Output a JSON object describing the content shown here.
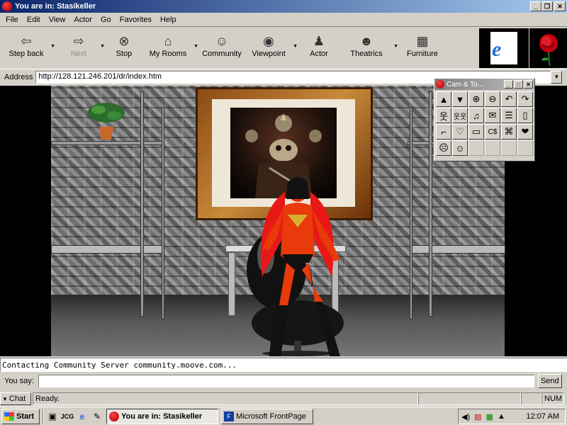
{
  "window": {
    "title": "You are in: Stasikeller"
  },
  "menu": [
    "File",
    "Edit",
    "View",
    "Actor",
    "Go",
    "Favorites",
    "Help"
  ],
  "toolbar": [
    {
      "label": "Step back",
      "icon": "back-arrow-icon",
      "glyph": "⇦",
      "dropdown": true
    },
    {
      "label": "Next",
      "icon": "forward-arrow-icon",
      "glyph": "⇨",
      "dropdown": true,
      "disabled": true
    },
    {
      "label": "Stop",
      "icon": "stop-icon",
      "glyph": "⊗"
    },
    {
      "label": "My Rooms",
      "icon": "house-icon",
      "glyph": "⌂",
      "dropdown": true
    },
    {
      "label": "Community",
      "icon": "community-icon",
      "glyph": "☺"
    },
    {
      "label": "Viewpoint",
      "icon": "eye-icon",
      "glyph": "◉",
      "dropdown": true
    },
    {
      "label": "Actor",
      "icon": "actor-icon",
      "glyph": "♟"
    },
    {
      "label": "Theatrics",
      "icon": "theater-masks-icon",
      "glyph": "☻",
      "dropdown": true
    },
    {
      "label": "Furniture",
      "icon": "furniture-icon",
      "glyph": "▦"
    }
  ],
  "address": {
    "label": "Address",
    "url": "http://128.121.246.201/dr/index.htm"
  },
  "cam_tools": {
    "title": "Cam & To...",
    "buttons": [
      "▲",
      "▼",
      "⊕",
      "⊖",
      "↶",
      "↷",
      "웃",
      "웃웃",
      "♫",
      "✉",
      "☰",
      "▯",
      "⌐",
      "♡",
      "▭",
      "C$",
      "⌘",
      "❤",
      "☹",
      "☺",
      "",
      "",
      "",
      ""
    ]
  },
  "log": {
    "text": "Contacting Community Server community.moove.com..."
  },
  "chat": {
    "say_label": "You say:",
    "send_label": "Send"
  },
  "status": {
    "chat_label": "Chat",
    "text": "Ready.",
    "num": "NUM"
  },
  "taskbar": {
    "start_label": "Start",
    "tasks": [
      {
        "label": "You are in: Stasikeller",
        "active": true
      },
      {
        "label": "Microsoft FrontPage",
        "active": false
      }
    ],
    "clock": "12:07 AM"
  }
}
